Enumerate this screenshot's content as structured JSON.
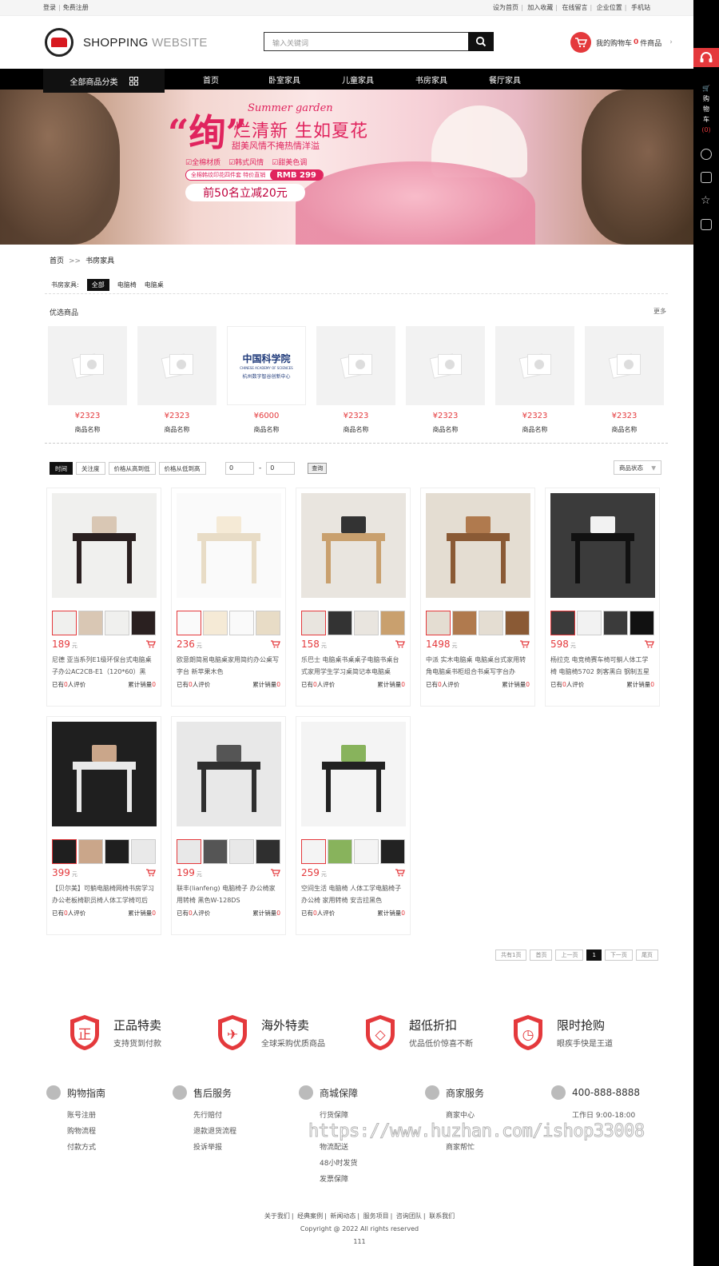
{
  "topbar": {
    "left": [
      "登录",
      "免费注册"
    ],
    "right": [
      "设为首页",
      "加入收藏",
      "在线留言",
      "企业位置",
      "手机站"
    ]
  },
  "logo": {
    "text_main": "SHOPPING",
    "text_light": "WEBSITE"
  },
  "search": {
    "placeholder": "输入关键词"
  },
  "cart": {
    "label_pre": "我的购物车",
    "count": "0",
    "label_post": "件商品"
  },
  "nav": {
    "category": "全部商品分类",
    "items": [
      "首页",
      "卧室家具",
      "儿童家具",
      "书房家具",
      "餐厅家具"
    ]
  },
  "banner": {
    "big_char": "“绚”",
    "title": "烂清新 生如夏花",
    "script": "Summer garden",
    "subtitle": "甜美风情不掩热情洋溢",
    "features": [
      "☑全棉材质",
      "☑韩式风情",
      "☑甜美色调"
    ],
    "promo_text": "全棉韩纹印花四件套 特价直销",
    "promo_price": "RMB 299",
    "sale": "前50名立减20元"
  },
  "breadcrumb": {
    "home": "首页",
    "sep": ">>",
    "current": "书房家具"
  },
  "filter": {
    "label": "书房家具:",
    "options": [
      "全部",
      "电脑椅",
      "电脑桌"
    ]
  },
  "recommend": {
    "title": "优选商品",
    "more": "更多",
    "items": [
      {
        "price": "¥2323",
        "name": "商品名称"
      },
      {
        "price": "¥2323",
        "name": "商品名称"
      },
      {
        "price": "¥6000",
        "name": "商品名称",
        "logo_cn": "中国科学院",
        "logo_en": "CHINESE ACADEMY OF SCIENCES",
        "logo_sub": "杭州数字智谷创新中心"
      },
      {
        "price": "¥2323",
        "name": "商品名称"
      },
      {
        "price": "¥2323",
        "name": "商品名称"
      },
      {
        "price": "¥2323",
        "name": "商品名称"
      },
      {
        "price": "¥2323",
        "name": "商品名称"
      }
    ]
  },
  "sort": {
    "buttons": [
      "时间",
      "关注度",
      "价格从高到低",
      "价格从低到高"
    ],
    "min": "0",
    "dash": "-",
    "max": "0",
    "query": "查询",
    "status": "商品状态"
  },
  "products": [
    {
      "price": "189",
      "unit": "元",
      "desc": "尼德 亚当系列E1级环保台式电脑桌子办公AC2CB-E1（120*60）黑",
      "reviews_pre": "已有",
      "reviews": "0",
      "reviews_post": "人评价",
      "sales_pre": "累计销量",
      "sales": "0"
    },
    {
      "price": "236",
      "unit": "元",
      "desc": "欧意朗简易电脑桌家用简约办公桌写字台 新苹果木色",
      "reviews_pre": "已有",
      "reviews": "0",
      "reviews_post": "人评价",
      "sales_pre": "累计销量",
      "sales": "0"
    },
    {
      "price": "158",
      "unit": "元",
      "desc": "乐巴士 电脑桌书桌桌子电脑书桌台式家用学生学习桌简记本电脑桌",
      "reviews_pre": "已有",
      "reviews": "0",
      "reviews_post": "人评价",
      "sales_pre": "累计销量",
      "sales": "0"
    },
    {
      "price": "1498",
      "unit": "元",
      "desc": "中派 实木电脑桌 电脑桌台式家用转角电脑桌书柜组合书桌写字台办",
      "reviews_pre": "已有",
      "reviews": "0",
      "reviews_post": "人评价",
      "sales_pre": "累计销量",
      "sales": "0"
    },
    {
      "price": "598",
      "unit": "元",
      "desc": "杨拉克 电竞椅赛车椅可躺人体工学椅 电脑椅5702 刺客黑白 钢制五星",
      "reviews_pre": "已有",
      "reviews": "0",
      "reviews_post": "人评价",
      "sales_pre": "累计销量",
      "sales": "0"
    },
    {
      "price": "399",
      "unit": "元",
      "desc": "【贝尔美】可躺电脑椅网椅书房学习办公老板椅职员椅人体工学椅可后",
      "reviews_pre": "已有",
      "reviews": "0",
      "reviews_post": "人评价",
      "sales_pre": "累计销量",
      "sales": "0"
    },
    {
      "price": "199",
      "unit": "元",
      "desc": "联丰(lianfeng) 电脑椅子 办公椅家用转椅 黑色W-128DS",
      "reviews_pre": "已有",
      "reviews": "0",
      "reviews_post": "人评价",
      "sales_pre": "累计销量",
      "sales": "0"
    },
    {
      "price": "259",
      "unit": "元",
      "desc": "空间生活 电脑椅 人体工学电脑椅子 办公椅 家用转椅 安吉拉黑色",
      "reviews_pre": "已有",
      "reviews": "0",
      "reviews_post": "人评价",
      "sales_pre": "累计销量",
      "sales": "0"
    }
  ],
  "pager": [
    "共有1页",
    "首页",
    "上一页",
    "1",
    "下一页",
    "尾页"
  ],
  "guarantees": [
    {
      "title": "正品特卖",
      "sub": "支持货到付款",
      "glyph": "正"
    },
    {
      "title": "海外特卖",
      "sub": "全球采购优质商品",
      "glyph": "✈"
    },
    {
      "title": "超低折扣",
      "sub": "优品低价惊喜不断",
      "glyph": "◇"
    },
    {
      "title": "限时抢购",
      "sub": "眼疾手快是王道",
      "glyph": "◷"
    }
  ],
  "footer_cols": [
    {
      "title": "购物指南",
      "icon": "bag-icon",
      "links": [
        "账号注册",
        "购物流程",
        "付款方式"
      ]
    },
    {
      "title": "售后服务",
      "icon": "wallet-icon",
      "links": [
        "先行赔付",
        "退款退货流程",
        "投诉举报"
      ]
    },
    {
      "title": "商城保障",
      "icon": "shield-icon",
      "links": [
        "行货保障",
        "",
        "物流配送",
        "48小时发货",
        "发票保障"
      ]
    },
    {
      "title": "商家服务",
      "icon": "user-icon",
      "links": [
        "商家中心",
        "",
        "商家帮忙"
      ]
    },
    {
      "title": "400-888-8888",
      "icon": "phone-icon",
      "links": [
        "工作日 9:00-18:00",
        ""
      ]
    }
  ],
  "watermark": "https://www.huzhan.com/ishop33008",
  "bottom": {
    "links": [
      "关于我们",
      "经典案例",
      "新闻动态",
      "服务项目",
      "咨询团队",
      "联系我们"
    ],
    "copyright": "Copyright @ 2022   All rights reserved",
    "extra": "111"
  },
  "right_sidebar": {
    "cart_label": [
      "购",
      "物",
      "车"
    ],
    "cart_count": "(0)"
  },
  "colors": {
    "accent": "#e4393c",
    "dark": "#000000"
  }
}
